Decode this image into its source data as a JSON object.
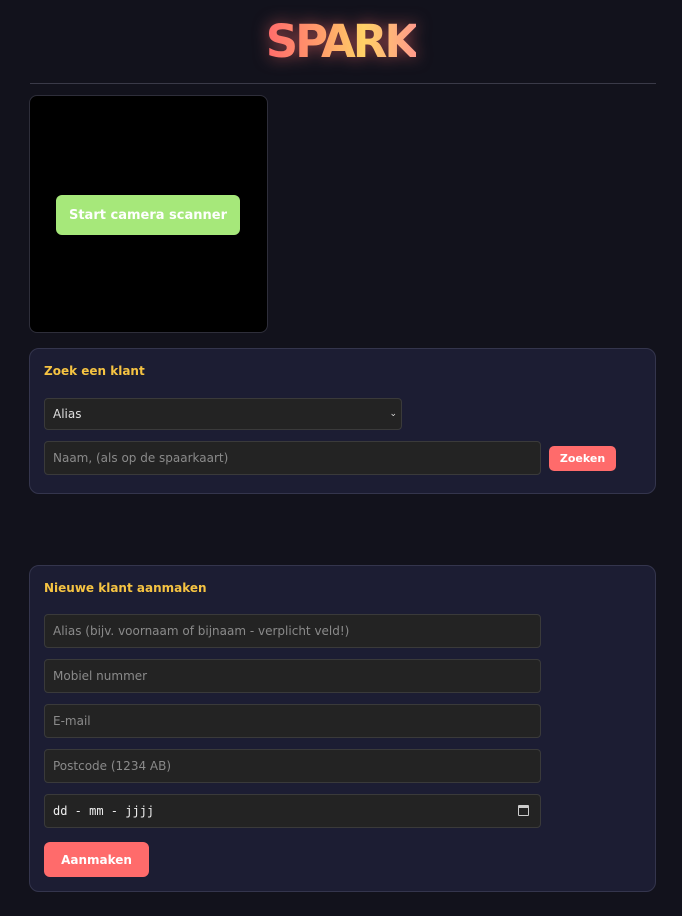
{
  "app": {
    "title": "SPARK"
  },
  "scanner": {
    "button_label": "Start camera scanner"
  },
  "search": {
    "title": "Zoek een klant",
    "select_value": "Alias",
    "name_placeholder": "Naam, (als op de spaarkaart)",
    "search_label": "Zoeken"
  },
  "create": {
    "title": "Nieuwe klant aanmaken",
    "alias_placeholder": "Alias (bijv. voornaam of bijnaam - verplicht veld!)",
    "mobile_placeholder": "Mobiel nummer",
    "email_placeholder": "E-mail",
    "postcode_placeholder": "Postcode (1234 AB)",
    "date_value": "dd - mm - jjjj",
    "submit_label": "Aanmaken"
  },
  "colors": {
    "background": "#12121c",
    "card": "#1c1d33",
    "accent": "#ff6b6b",
    "scanner_button": "#a6e87a",
    "card_title": "#f5c342"
  },
  "icons": {
    "select_chevron": "chevron-down-icon",
    "date_picker": "calendar-icon"
  }
}
